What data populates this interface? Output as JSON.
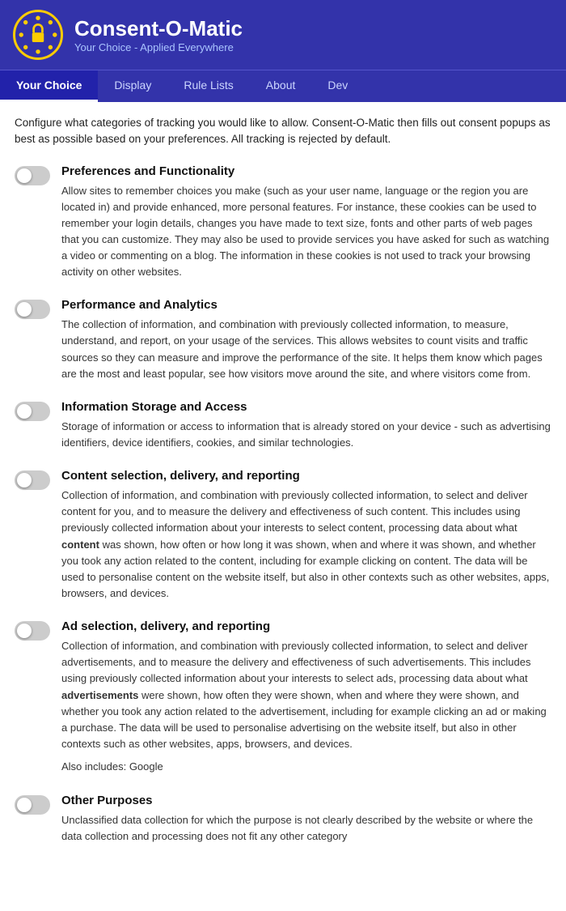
{
  "header": {
    "title": "Consent-O-Matic",
    "subtitle": "Your Choice - Applied Everywhere"
  },
  "nav": {
    "items": [
      {
        "label": "Your Choice",
        "active": true
      },
      {
        "label": "Display",
        "active": false
      },
      {
        "label": "Rule Lists",
        "active": false
      },
      {
        "label": "About",
        "active": false
      },
      {
        "label": "Dev",
        "active": false
      }
    ]
  },
  "intro": "Configure what categories of tracking you would like to allow. Consent-O-Matic then fills out consent popups as best as possible based on your preferences. All tracking is rejected by default.",
  "categories": [
    {
      "id": "preferences",
      "title": "Preferences and Functionality",
      "description": "Allow sites to remember choices you make (such as your user name, language or the region you are located in) and provide enhanced, more personal features. For instance, these cookies can be used to remember your login details, changes you have made to text size, fonts and other parts of web pages that you can customize. They may also be used to provide services you have asked for such as watching a video or commenting on a blog. The information in these cookies is not used to track your browsing activity on other websites.",
      "bold_word": null,
      "also_includes": null
    },
    {
      "id": "performance",
      "title": "Performance and Analytics",
      "description": "The collection of information, and combination with previously collected information, to measure, understand, and report, on your usage of the services. This allows websites to count visits and traffic sources so they can measure and improve the performance of the site. It helps them know which pages are the most and least popular, see how visitors move around the site, and where visitors come from.",
      "bold_word": null,
      "also_includes": null
    },
    {
      "id": "storage",
      "title": "Information Storage and Access",
      "description": "Storage of information or access to information that is already stored on your device - such as advertising identifiers, device identifiers, cookies, and similar technologies.",
      "bold_word": null,
      "also_includes": null
    },
    {
      "id": "content",
      "title": "Content selection, delivery, and reporting",
      "description_before": "Collection of information, and combination with previously collected information, to select and deliver content for you, and to measure the delivery and effectiveness of such content. This includes using previously collected information about your interests to select content, processing data about what ",
      "bold_word": "content",
      "description_after": " was shown, how often or how long it was shown, when and where it was shown, and whether you took any action related to the content, including for example clicking on content. The data will be used to personalise content on the website itself, but also in other contexts such as other websites, apps, browsers, and devices.",
      "also_includes": null
    },
    {
      "id": "ads",
      "title": "Ad selection, delivery, and reporting",
      "description_before": "Collection of information, and combination with previously collected information, to select and deliver advertisements, and to measure the delivery and effectiveness of such advertisements. This includes using previously collected information about your interests to select ads, processing data about what ",
      "bold_word": "advertisements",
      "description_after": " were shown, how often they were shown, when and where they were shown, and whether you took any action related to the advertisement, including for example clicking an ad or making a purchase. The data will be used to personalise advertising on the website itself, but also in other contexts such as other websites, apps, browsers, and devices.",
      "also_includes": "Also includes:\nGoogle"
    },
    {
      "id": "other",
      "title": "Other Purposes",
      "description": "Unclassified data collection for which the purpose is not clearly described by the website or where the data collection and processing does not fit any other category",
      "bold_word": null,
      "also_includes": null
    }
  ]
}
